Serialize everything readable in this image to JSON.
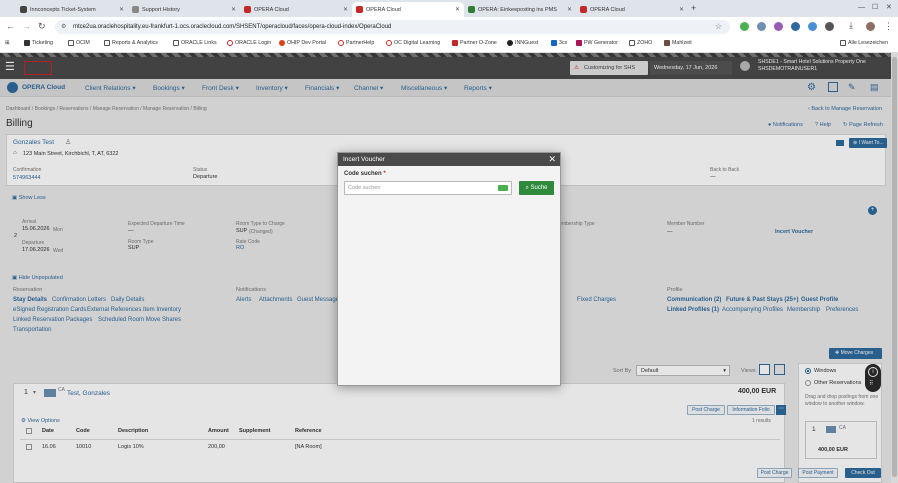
{
  "browser": {
    "tabs": [
      {
        "label": "Innconcepts Ticket-System",
        "color": "#444"
      },
      {
        "label": "Support History",
        "color": "#888"
      },
      {
        "label": "OPERA Cloud",
        "color": "#c62828"
      },
      {
        "label": "OPERA Cloud",
        "color": "#c62828"
      },
      {
        "label": "OPERA: Einkeeposting ins PMS",
        "color": "#2e7d32"
      },
      {
        "label": "OPERA Cloud",
        "color": "#c62828"
      }
    ],
    "new_tab": "+",
    "url": "mtce2ua.oraclehospitality.eu-frankfurt-1.ocs.oraclecloud.com/SHSENT/operacloud/faces/opera-cloud-index/OperaCloud",
    "bookmarks": [
      "Ticketing",
      "OCIM",
      "Reports & Analytics",
      "ORACLE Links",
      "ORACLE Login",
      "OHIP Dev Portal",
      "PartnerHelp",
      "OC Digital Learning",
      "Partner O-Zone",
      "INNGuest",
      "3cx",
      "PW Generator",
      "ZOHO",
      "Mahlzeit"
    ],
    "all_bookmarks": "Alle Lesezeichen"
  },
  "opera": {
    "logo": "OPERA Cloud",
    "warning": "Customizing for SHS",
    "date": "Wednesday, 17 Jun, 2026",
    "property_line1": "SHSDE1 - Smart Hotel Solutions Property One",
    "property_line2": "SHSDEMOTRAINUSER1",
    "menu": [
      "Client Relations",
      "Bookings",
      "Front Desk",
      "Inventory",
      "Financials",
      "Channel",
      "Miscellaneous",
      "Reports"
    ]
  },
  "page": {
    "breadcrumb": "Dashboard / Bookings / Reservations / Manage Reservation / Manage Reservation / Billing",
    "back_link": "Back to Manage Reservation",
    "title": "Billing",
    "notifications": "Notifications",
    "help": "Help",
    "refresh": "Page Refresh",
    "i_want_to": "I Want To...",
    "guest_name": "Gonzales Test",
    "guest_address": "123 Main Street, Kirchbichl, T, AT, 6322",
    "confirmation_label": "Confirmation",
    "confirmation_value": "574963444",
    "status_label": "Status",
    "status_value": "Departure",
    "back_to_back_label": "Back to Back",
    "show_less": "Show Less",
    "arrival_label": "Arrival",
    "arrival_value": "15.06.2026",
    "arrival_day": "Mon",
    "nights": "2",
    "departure_label": "Departure",
    "departure_value": "17.06.2026",
    "departure_day": "Wed",
    "exp_dep_time_label": "Expected Departure Time",
    "exp_dep_time_value": "—",
    "room_type_label": "Room Type",
    "room_type_value": "SUP",
    "rtc_label": "Room Type to Charge",
    "rtc_value": "SUP",
    "rtc_note": "(Changed)",
    "rate_code_label": "Rate Code",
    "rate_code_value": "RO",
    "membership_type_label": "Membership Type",
    "member_number_label": "Member Number",
    "member_number_value": "—",
    "incert_voucher_link": "Incert Voucher",
    "hide_unpopulated": "Hide Unpopulated",
    "reservation_header": "Reservation",
    "reservation_links": [
      "Stay Details",
      "Confirmation Letters",
      "Daily Details",
      "eSigned Registration Cards",
      "External References",
      "Item Inventory",
      "Linked Reservation",
      "Packages",
      "Scheduled Room Move",
      "Shares",
      "Transportation"
    ],
    "notifications_header": "Notifications",
    "notifications_links": [
      "Alerts",
      "Attachments",
      "Guest Messages"
    ],
    "fixed_charges": "Fixed Charges",
    "profile_header": "Profile",
    "profile_links": [
      "Communication (2)",
      "Future & Past Stays (25+)",
      "Guest Profile",
      "Linked Profiles (1)",
      "Accompanying Profiles",
      "Membership",
      "Preferences"
    ],
    "move_charges": "Move Charges",
    "sort_by_label": "Sort By",
    "sort_by_value": "Default",
    "views_label": "Views",
    "window_number": "1",
    "window_ca": "CA",
    "window_name": "Test, Gonzales",
    "window_total": "400,00 EUR",
    "post_charge": "Post Charge",
    "information_folio": "Information Folio",
    "results_count": "1 results",
    "view_options": "View Options",
    "table_headers": [
      "Date",
      "Code",
      "Description",
      "Amount",
      "Supplement",
      "Reference"
    ],
    "table_row": {
      "date": "16.06",
      "code": "10010",
      "description": "Logis 10%",
      "amount": "200,00",
      "supplement": "",
      "reference": "[NA Room]"
    },
    "radio_windows": "Windows",
    "radio_other": "Other Reservations",
    "drag_hint": "Drag and drop postings from one window to another window.",
    "side_window_number": "1",
    "side_window_ca": "CA",
    "side_window_total": "400,00 EUR",
    "footer_post_charge": "Post Charge",
    "footer_post_payment": "Post Payment",
    "footer_check_out": "Check Out"
  },
  "dialog": {
    "title": "Incert Voucher",
    "close": "✕",
    "field_label": "Code suchen",
    "required_mark": "*",
    "placeholder": "Code suchen",
    "search_button": "Suche"
  }
}
